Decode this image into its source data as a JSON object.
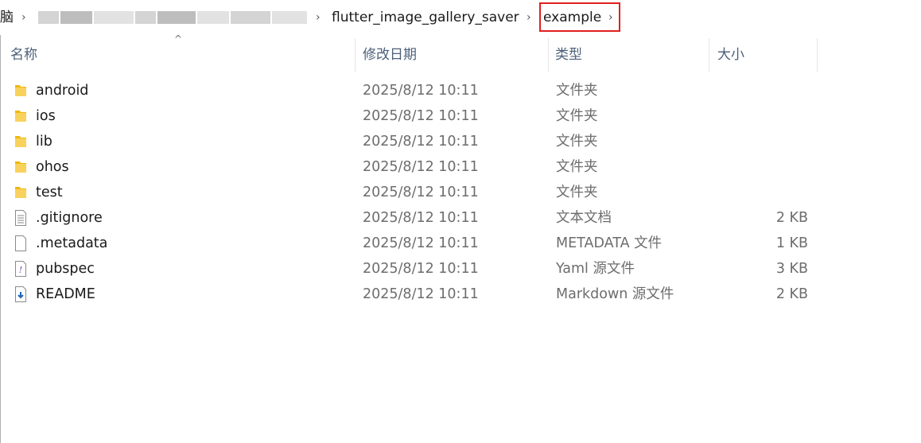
{
  "address_bar": {
    "partial_segment": "脑",
    "segments": [
      "flutter_image_gallery_saver",
      "example"
    ],
    "separator": "›"
  },
  "columns": {
    "name": "名称",
    "modified": "修改日期",
    "type": "类型",
    "size": "大小",
    "sort_indicator": "^"
  },
  "files": [
    {
      "name": "android",
      "modified": "2025/8/12 10:11",
      "type": "文件夹",
      "size": "",
      "icon": "folder-icon"
    },
    {
      "name": "ios",
      "modified": "2025/8/12 10:11",
      "type": "文件夹",
      "size": "",
      "icon": "folder-icon"
    },
    {
      "name": "lib",
      "modified": "2025/8/12 10:11",
      "type": "文件夹",
      "size": "",
      "icon": "folder-icon"
    },
    {
      "name": "ohos",
      "modified": "2025/8/12 10:11",
      "type": "文件夹",
      "size": "",
      "icon": "folder-icon"
    },
    {
      "name": "test",
      "modified": "2025/8/12 10:11",
      "type": "文件夹",
      "size": "",
      "icon": "folder-icon"
    },
    {
      "name": ".gitignore",
      "modified": "2025/8/12 10:11",
      "type": "文本文档",
      "size": "2 KB",
      "icon": "text-file-icon"
    },
    {
      "name": ".metadata",
      "modified": "2025/8/12 10:11",
      "type": "METADATA 文件",
      "size": "1 KB",
      "icon": "blank-file-icon"
    },
    {
      "name": "pubspec",
      "modified": "2025/8/12 10:11",
      "type": "Yaml 源文件",
      "size": "3 KB",
      "icon": "yaml-file-icon"
    },
    {
      "name": "README",
      "modified": "2025/8/12 10:11",
      "type": "Markdown 源文件",
      "size": "2 KB",
      "icon": "markdown-file-icon"
    }
  ],
  "colors": {
    "folder": "#f4c430",
    "highlight": "#e02020",
    "header_text": "#4c607a"
  }
}
